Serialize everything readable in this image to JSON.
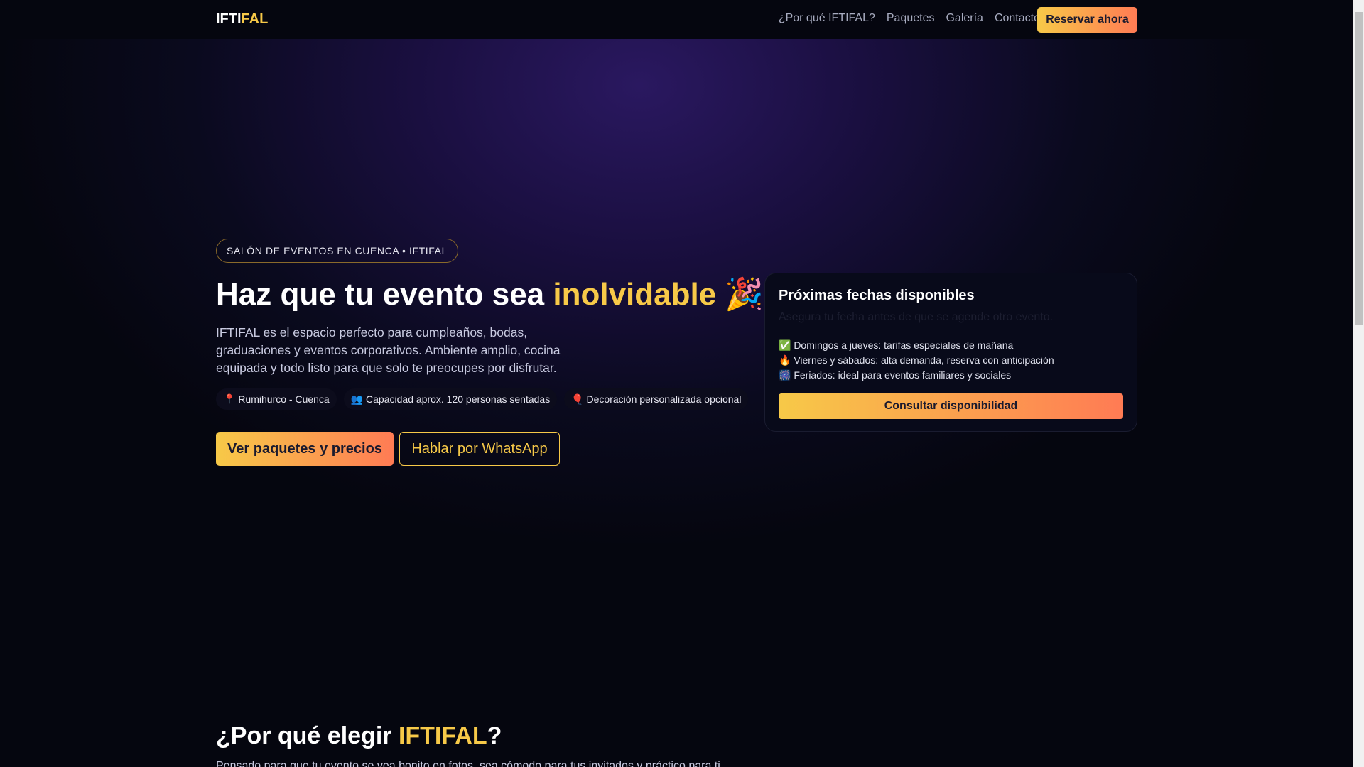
{
  "nav": {
    "logo_a": "IFTI",
    "logo_b": "FAL",
    "links": [
      "¿Por qué IFTIFAL?",
      "Paquetes",
      "Galería",
      "Contacto"
    ],
    "cta": "Reservar ahora"
  },
  "hero": {
    "badge": "SALÓN DE EVENTOS EN CUENCA • IFTIFAL",
    "title_a": "Haz que tu evento sea ",
    "title_b": "inolvidable",
    "title_emoji": "🎉",
    "lead": "IFTIFAL es el espacio perfecto para cumpleaños, bodas, graduaciones y eventos corporativos. Ambiente amplio, cocina equipada y todo listo para que solo te preocupes por disfrutar.",
    "chips": [
      "📍 Rumihurco - Cuenca",
      "👥 Capacidad aprox. 120 personas sentadas",
      "🎈 Decoración personalizada opcional"
    ],
    "primary_btn": "Ver paquetes y precios",
    "secondary_btn": "Hablar por WhatsApp"
  },
  "card": {
    "title": "Próximas fechas disponibles",
    "subtitle": "Asegura tu fecha antes de que se agende otro evento.",
    "items": [
      "✅ Domingos a jueves: tarifas especiales de mañana",
      "🔥 Viernes y sábados: alta demanda, reserva con anticipación",
      "🎆 Feriados: ideal para eventos familiares y sociales"
    ],
    "button": "Consultar disponibilidad"
  },
  "why": {
    "title_a": "¿Por qué elegir ",
    "title_b": "IFTIFAL",
    "title_c": "?",
    "text": "Pensado para que tu evento se vea bonito en fotos, sea cómodo para tus invitados y práctico para ti."
  }
}
